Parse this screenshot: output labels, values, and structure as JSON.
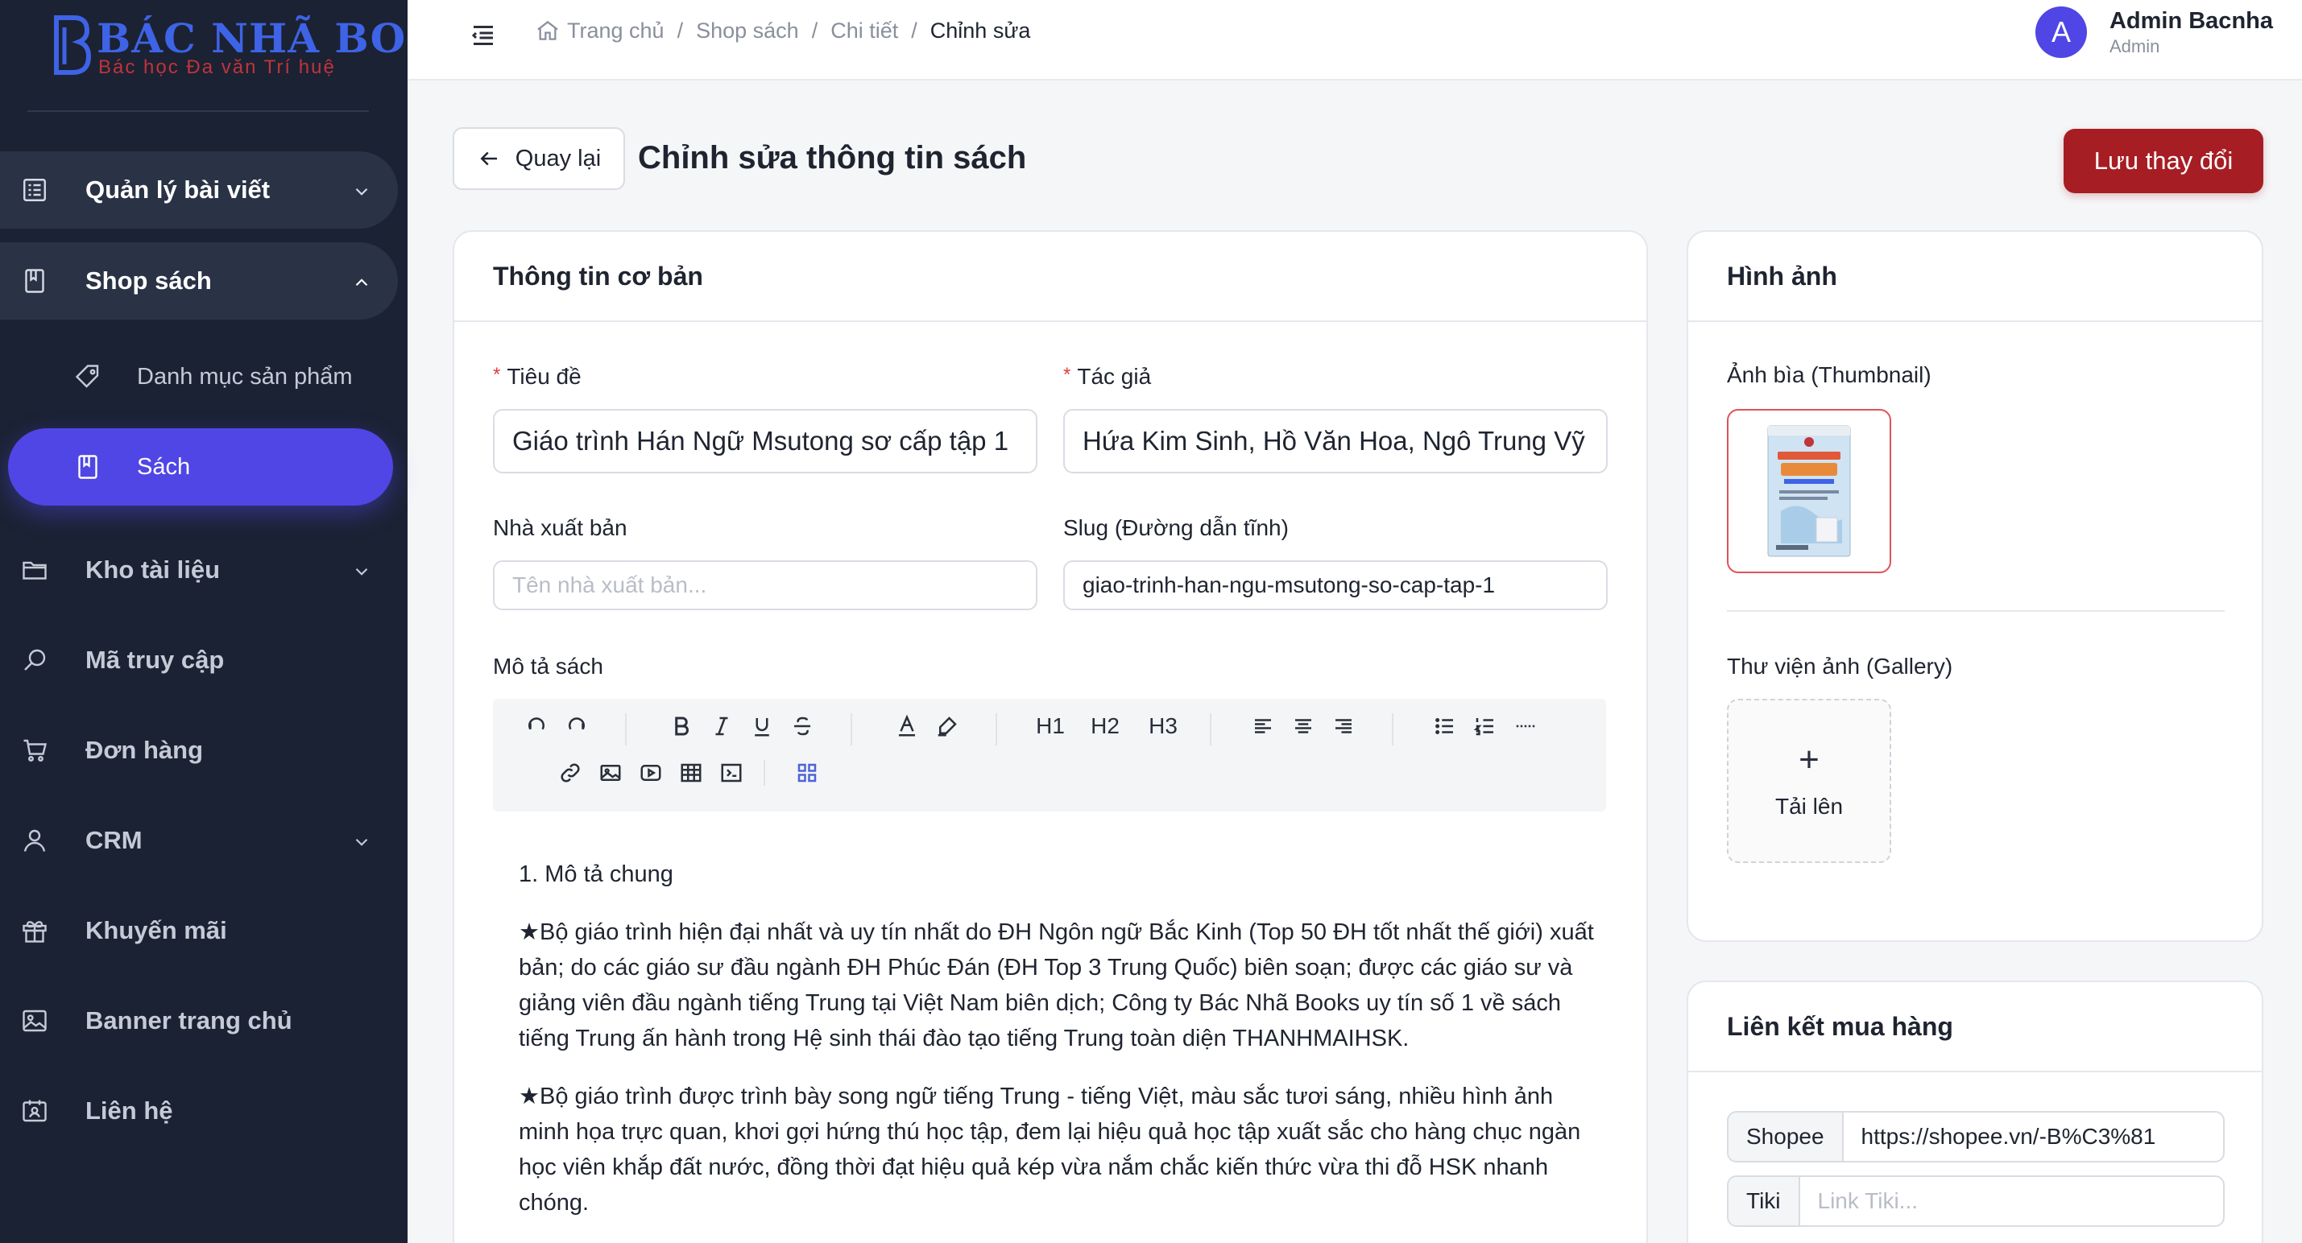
{
  "brand": {
    "title": "BÁC NHÃ BOOKS",
    "tagline": "Bác học Đa văn Trí huệ"
  },
  "sidebar": {
    "items": [
      {
        "label": "Quản lý bài viết",
        "icon": "list-icon"
      },
      {
        "label": "Shop sách",
        "icon": "book-icon"
      },
      {
        "label": "Danh mục sản phẩm",
        "icon": "tag-icon"
      },
      {
        "label": "Sách",
        "icon": "book-icon"
      },
      {
        "label": "Kho tài liệu",
        "icon": "folder-icon"
      },
      {
        "label": "Mã truy cập",
        "icon": "search-icon"
      },
      {
        "label": "Đơn hàng",
        "icon": "cart-icon"
      },
      {
        "label": "CRM",
        "icon": "user-icon"
      },
      {
        "label": "Khuyến mãi",
        "icon": "gift-icon"
      },
      {
        "label": "Banner trang chủ",
        "icon": "image-icon"
      },
      {
        "label": "Liên hệ",
        "icon": "contact-icon"
      }
    ],
    "accent_color": "#4f46e5",
    "background_color": "#1b2233"
  },
  "breadcrumb": {
    "items": [
      "Trang chủ",
      "Shop sách",
      "Chi tiết",
      "Chỉnh sửa"
    ],
    "separator": "/"
  },
  "user": {
    "initial": "A",
    "name": "Admin Bacnha",
    "role": "Admin"
  },
  "page": {
    "back_label": "Quay lại",
    "title": "Chỉnh sửa thông tin sách",
    "save_label": "Lưu thay đổi",
    "save_color": "#a61e24"
  },
  "basic_info": {
    "heading": "Thông tin cơ bản",
    "title_label": "Tiêu đề",
    "title_value": "Giáo trình Hán Ngữ Msutong sơ cấp tập 1",
    "author_label": "Tác giả",
    "author_value": "Hứa Kim Sinh, Hồ Văn Hoa, Ngô Trung Vỹ",
    "publisher_label": "Nhà xuất bản",
    "publisher_placeholder": "Tên nhà xuất bản...",
    "slug_label": "Slug (Đường dẫn tĩnh)",
    "slug_value": "giao-trinh-han-ngu-msutong-so-cap-tap-1",
    "required_mark": "*",
    "description_label": "Mô tả sách"
  },
  "editor": {
    "headings": [
      "H1",
      "H2",
      "H3"
    ],
    "paragraphs": [
      "1. Mô tả chung",
      "★Bộ giáo trình hiện đại nhất và uy tín nhất do ĐH Ngôn ngữ Bắc Kinh (Top 50 ĐH tốt nhất thế giới) xuất bản; do các giáo sư đầu ngành ĐH Phúc Đán (ĐH Top 3 Trung Quốc) biên soạn; được các giáo sư và giảng viên đầu ngành tiếng Trung tại Việt Nam biên dịch; Công ty Bác Nhã Books uy tín số 1 về sách tiếng Trung ấn hành trong Hệ sinh thái đào tạo tiếng Trung toàn diện THANHMAIHSK.",
      "★Bộ giáo trình được trình bày song ngữ tiếng Trung - tiếng Việt, màu sắc tươi sáng, nhiều hình ảnh minh họa trực quan, khơi gợi hứng thú học tập, đem lại hiệu quả học tập xuất sắc cho hàng chục ngàn học viên khắp đất nước, đồng thời đạt hiệu quả kép vừa nắm chắc kiến thức vừa thi đỗ HSK nhanh chóng."
    ]
  },
  "images": {
    "heading": "Hình ảnh",
    "thumbnail_label": "Ảnh bìa (Thumbnail)",
    "gallery_label": "Thư viện ảnh (Gallery)",
    "upload_icon": "+",
    "upload_label": "Tải lên"
  },
  "purchase_links": {
    "heading": "Liên kết mua hàng",
    "links": [
      {
        "name": "Shopee",
        "value": "https://shopee.vn/-B%C3%81",
        "placeholder": ""
      },
      {
        "name": "Tiki",
        "value": "",
        "placeholder": "Link Tiki..."
      }
    ]
  }
}
